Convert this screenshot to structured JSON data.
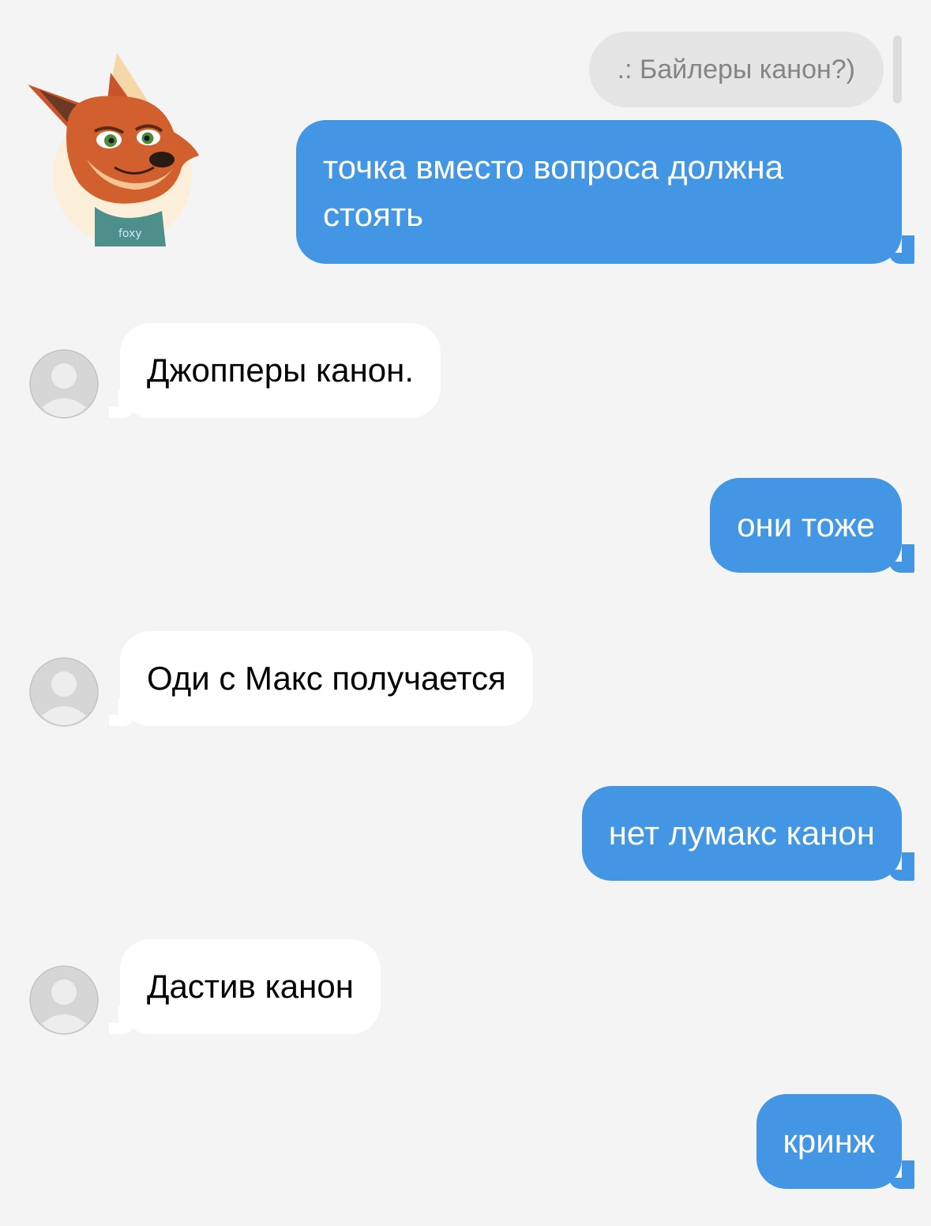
{
  "chat": {
    "quote": {
      "text": ".: Байлеры канон?)"
    },
    "avatars": {
      "sender_icon": "fox-character-avatar",
      "others_icon": "default-user-avatar"
    },
    "messages": [
      {
        "side": "out",
        "text": "точка вместо вопроса должна стоять"
      },
      {
        "side": "in",
        "text": "Джопперы канон."
      },
      {
        "side": "out",
        "text": "они тоже"
      },
      {
        "side": "in",
        "text": "Оди с Макс получается"
      },
      {
        "side": "out",
        "text": "нет лумакс канон"
      },
      {
        "side": "in",
        "text": "Дастив канон"
      },
      {
        "side": "out",
        "text": "кринж"
      }
    ]
  },
  "colors": {
    "background": "#f4f4f4",
    "outgoing_bubble": "#4396e3",
    "incoming_bubble": "#ffffff",
    "quote_bubble": "#e5e5e5",
    "quote_text": "#858585",
    "avatar_placeholder": "#d6d6d6"
  }
}
